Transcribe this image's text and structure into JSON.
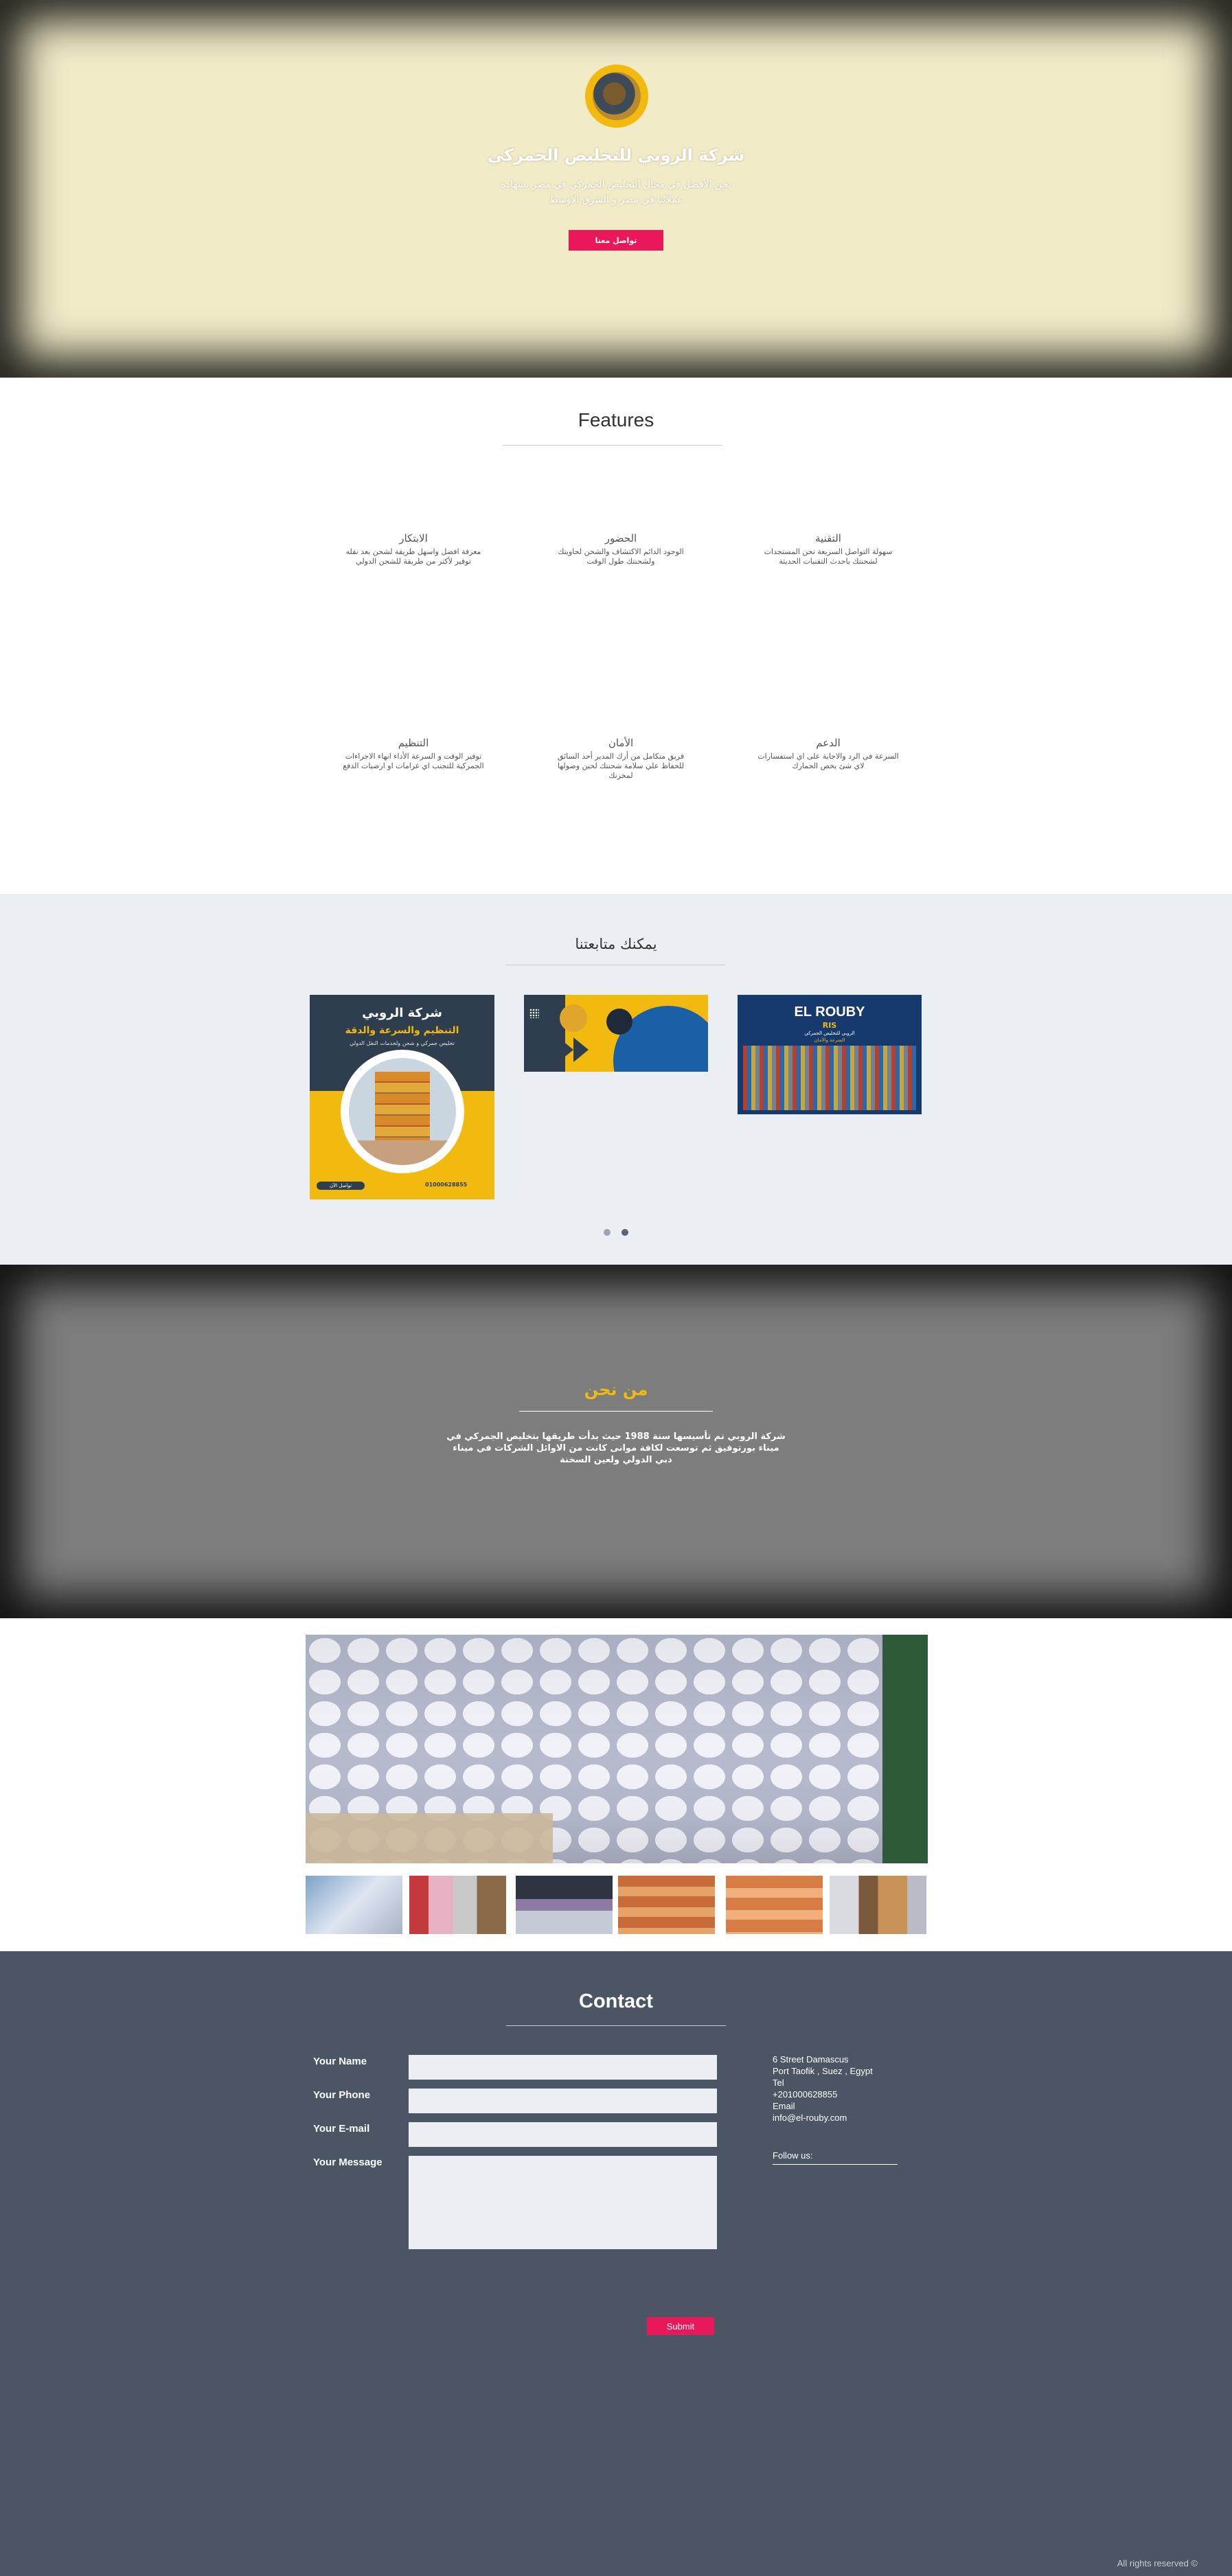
{
  "hero": {
    "title": "شركة الروبي للتخليص الجمركي",
    "subtitle": "نحن الأفضل في مجال التخليص الجمركي في مصر بشهادة عملائنا في مصر و الشرق الأوسط",
    "cta_label": "تواصل معنا"
  },
  "features": {
    "title": "Features",
    "items": [
      {
        "title": "التقنية",
        "desc": "سهولة التواصل السريعة نحن المستجدات لشحنتك باحدث التقنيات الحديثة"
      },
      {
        "title": "الحضور",
        "desc": "الوجود الدائم الاكتشاف والشحن لحاويتك ولشحنتك طول الوقت"
      },
      {
        "title": "الابتكار",
        "desc": "معرفة افضل واسهل طريقة لشحن بعد نقله توفير لأكثر من طريقة للشحن الدولي"
      },
      {
        "title": "الدعم",
        "desc": "السرعة في الرد والاجابة على اي استفسارات لاي شئ يخص الجمارك"
      },
      {
        "title": "الأمان",
        "desc": "فريق متكامل من أرك المدير أحد السائق للحفاظ علي سلامة شحنتك لحين وصولها لمخزنك"
      },
      {
        "title": "التنظيم",
        "desc": "توفير الوقت و السرعة الأداء انهاء الاجراءات الجمركية للتجنب اي غرامات او ارضيات الدفع"
      }
    ]
  },
  "follow": {
    "title": "يمكنك متابعتنا",
    "posts": [
      {
        "title": "شركة الروبي",
        "subtitle": "التنظيم والسرعة والدقة",
        "caption": "تخليص جمركي و شحن ولخدمات النقل الدولي",
        "button": "تواصل الآن",
        "phone": "01000628855"
      },
      {
        "title": "",
        "subtitle": ""
      },
      {
        "title": "EL ROUBY",
        "subtitle": "RIS",
        "caption": "الروبي للتخليص الجمركي",
        "tagline": "السرعة والأمان"
      }
    ],
    "active_dot": 1
  },
  "about": {
    "title": "من نحن",
    "text": "شركة الروبي تم تأسيسها سنة 1988 حيث بدأت طريقها بتخليص الجمركي في ميناء بورتوفيق ثم توسعت لكافة موانى كانت من الاوائل الشركات في ميناء دبي الدولي ولعين السخنة"
  },
  "contact": {
    "title": "Contact",
    "name_label": "Your Name",
    "phone_label": "Your Phone",
    "email_label": "Your E-mail",
    "message_label": "Your Message",
    "address1": "6 Street Damascus",
    "address2": "Port Taofik , Suez , Egypt",
    "tel_label": "Tel",
    "tel": "+201000628855",
    "email_label2": "Email",
    "email": "info@el-rouby.com",
    "follow_label": "Follow us:",
    "submit_label": "Submit"
  },
  "footer": {
    "rights": "All rights reserved ©"
  },
  "colors": {
    "accent": "#e8185a",
    "gold": "#f2b90f",
    "hero_bg": "#f1ebc8",
    "contact_bg": "#4b5564"
  }
}
